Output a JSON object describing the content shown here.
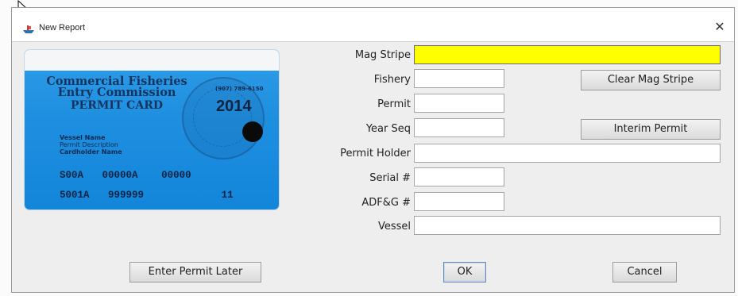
{
  "window": {
    "title": "New Report",
    "close_glyph": "✕"
  },
  "card": {
    "title_line1": "Commercial Fisheries",
    "title_line2": "Entry Commission",
    "title_line3": "PERMIT CARD",
    "phone": "(907) 789-6150",
    "year": "2014",
    "vessel_name": "Vessel Name",
    "permit_description": "Permit Description",
    "cardholder_name": "Cardholder Name",
    "row1": [
      "S00A",
      "00000A",
      "00000"
    ],
    "row2": [
      "5001A",
      "999999",
      "11"
    ]
  },
  "form": {
    "mag_stripe_label": "Mag Stripe",
    "fishery_label": "Fishery",
    "permit_label": "Permit",
    "year_seq_label": "Year Seq",
    "permit_holder_label": "Permit Holder",
    "serial_label": "Serial #",
    "adfg_label": "ADF&G #",
    "vessel_label": "Vessel",
    "mag_stripe_value": "",
    "fishery_value": "",
    "permit_value": "",
    "year_seq_value": "",
    "permit_holder_value": "",
    "serial_value": "",
    "adfg_value": "",
    "vessel_value": ""
  },
  "buttons": {
    "clear_mag_stripe": "Clear Mag Stripe",
    "interim_permit": "Interim Permit",
    "enter_permit_later": "Enter Permit Later",
    "ok": "OK",
    "cancel": "Cancel"
  },
  "icons": {
    "app": "fishing-boat-icon",
    "close": "close-icon",
    "cursor": "mouse-pointer-icon"
  },
  "colors": {
    "mag_stripe_bg": "#ffff00",
    "card_blue": "#1f8fe0"
  }
}
